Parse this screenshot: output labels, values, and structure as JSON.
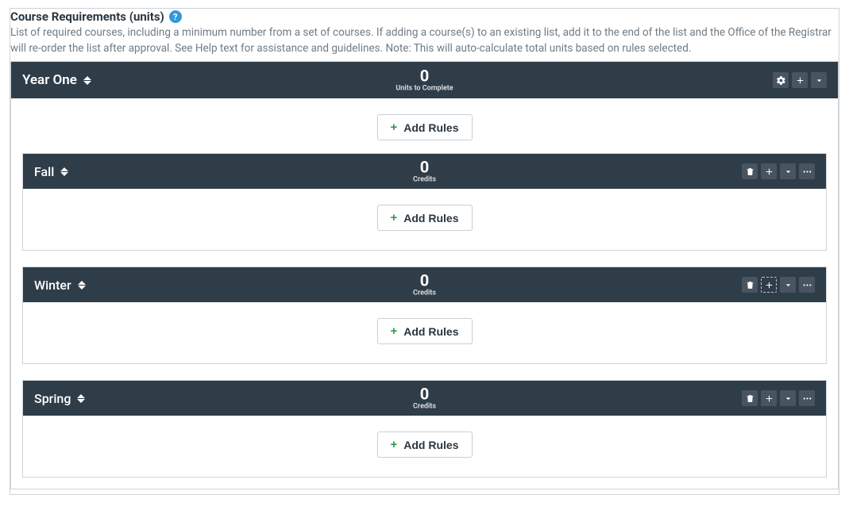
{
  "section": {
    "title": "Course Requirements (units)",
    "description": "List of required courses, including a minimum number from a set of courses. If adding a course(s) to an existing list, add it to the end of the list and the Office of the Registrar will re-order the list after approval. See Help text for assistance and guidelines. Note: This will auto-calculate total units based on rules selected."
  },
  "year": {
    "title": "Year One",
    "value": "0",
    "value_label": "Units to Complete",
    "add_rules_label": "Add Rules"
  },
  "terms": [
    {
      "title": "Fall",
      "value": "0",
      "value_label": "Credits",
      "add_rules_label": "Add Rules",
      "plus_dotted": false
    },
    {
      "title": "Winter",
      "value": "0",
      "value_label": "Credits",
      "add_rules_label": "Add Rules",
      "plus_dotted": true
    },
    {
      "title": "Spring",
      "value": "0",
      "value_label": "Credits",
      "add_rules_label": "Add Rules",
      "plus_dotted": false
    }
  ],
  "icons": {
    "gear": "gear-icon",
    "plus": "plus-icon",
    "chevron": "chevron-down-icon",
    "trash": "trash-icon",
    "more": "more-icon",
    "help": "?"
  }
}
